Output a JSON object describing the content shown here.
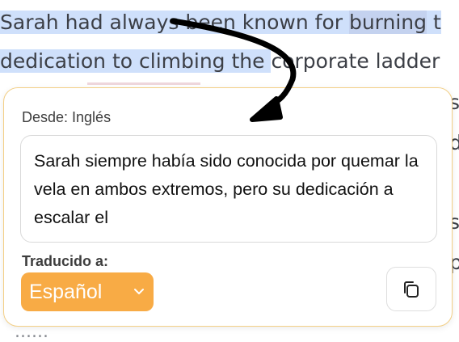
{
  "document": {
    "line1_a": "Sarah had alway",
    "line1_b": "s been known for ",
    "line1_c": "burning",
    "line1_d": " t",
    "line2_a": "dedication to climbing the ",
    "line2_b": "corporate ladder",
    "line3_frag": "s",
    "line4_frag": "d",
    "line5_frag": "s",
    "line6_frag": "p",
    "bottom_peek": "......"
  },
  "popup": {
    "from_label": "Desde: Inglés",
    "translation_text": "Sarah siempre había sido conocida por quemar la vela en ambos extremos, pero su dedicación a escalar el",
    "to_label": "Traducido a:",
    "selected_language": "Español",
    "border_color": "#f3cf86",
    "accent_color": "#f8ab45"
  },
  "icons": {
    "copy": "copy-icon",
    "chevron": "chevron-down-icon",
    "arrow": "curved-arrow-annotation"
  }
}
